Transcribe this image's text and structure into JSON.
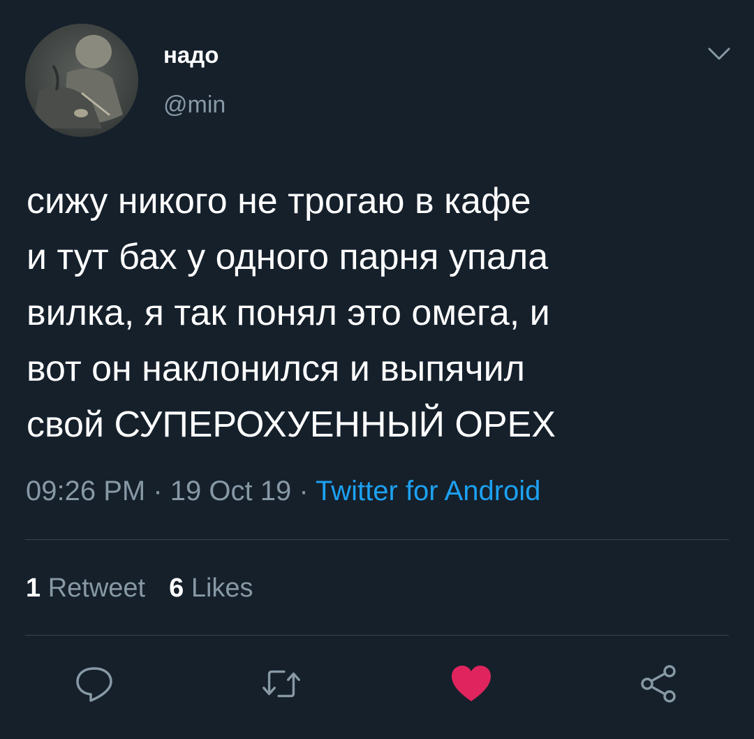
{
  "author": {
    "display_name": "надо",
    "handle": "@min"
  },
  "tweet": {
    "text": "сижу никого не трогаю в кафе\nи тут бах у одного парня упала\nвилка, я так понял это омега, и\nвот он наклонился и выпячил\nсвой СУПЕРОХУЕННЫЙ ОРЕХ",
    "time": "09:26 PM",
    "separator": " · ",
    "date": "19 Oct 19",
    "source": "Twitter for Android"
  },
  "stats": {
    "retweet_count": "1",
    "retweet_label": "Retweet",
    "like_count": "6",
    "like_label": "Likes"
  },
  "icons": {
    "menu": "chevron-down-icon",
    "reply": "reply-icon",
    "retweet": "retweet-icon",
    "like": "heart-icon",
    "share": "share-icon"
  },
  "colors": {
    "background": "#15202b",
    "secondary_text": "#8899a6",
    "link": "#1da1f2",
    "like_active": "#e0245e",
    "divider": "#38444d"
  }
}
